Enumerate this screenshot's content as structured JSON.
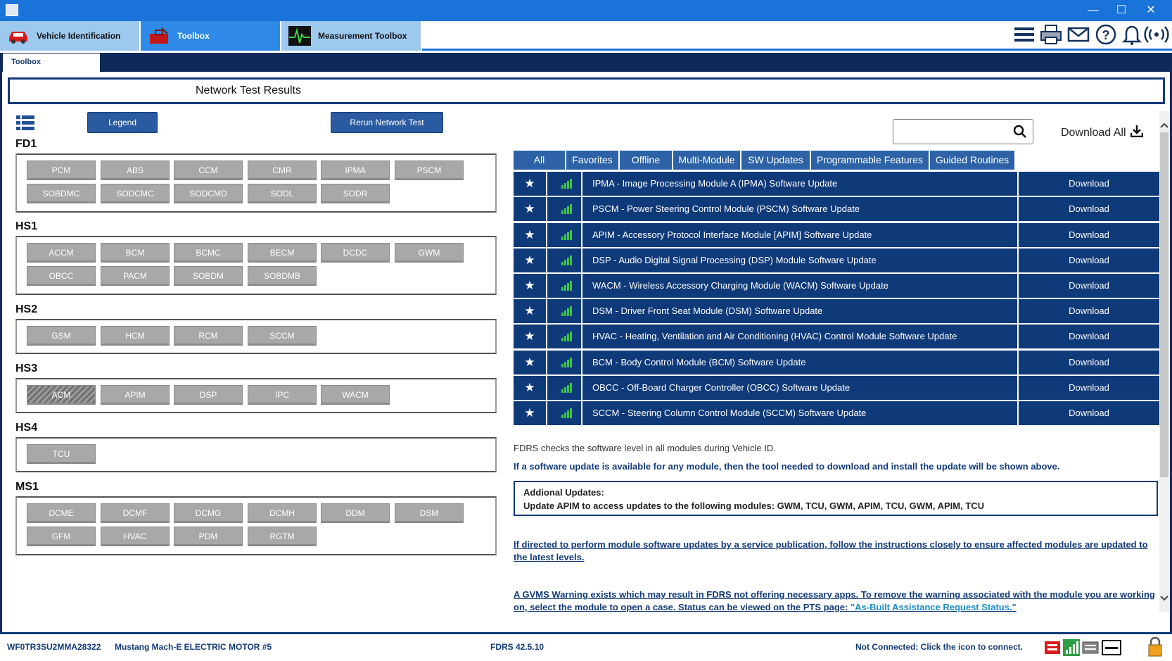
{
  "window": {
    "minimize": "—",
    "maximize": "☐",
    "close": "✕"
  },
  "top_tabs": [
    {
      "label": "Vehicle Identification",
      "icon": "car-icon"
    },
    {
      "label": "Toolbox",
      "icon": "toolbox-icon"
    },
    {
      "label": "Measurement Toolbox",
      "icon": "oscilloscope-icon"
    }
  ],
  "header_icons": [
    "menu-icon",
    "printer-icon",
    "mail-icon",
    "help-icon",
    "bell-icon",
    "wireless-icon"
  ],
  "sub_tab": "Toolbox",
  "page_title": "Network Test Results",
  "buttons": {
    "legend": "Legend",
    "rerun": "Rerun Network Test"
  },
  "groups": [
    {
      "name": "FD1",
      "modules": [
        "PCM",
        "ABS",
        "CCM",
        "CMR",
        "IPMA",
        "PSCM",
        "SOBDMC",
        "SODCMC",
        "SODCMD",
        "SODL",
        "SODR"
      ]
    },
    {
      "name": "HS1",
      "modules": [
        "ACCM",
        "BCM",
        "BCMC",
        "BECM",
        "DCDC",
        "GWM",
        "OBCC",
        "PACM",
        "SOBDM",
        "SOBDMB"
      ]
    },
    {
      "name": "HS2",
      "modules": [
        "GSM",
        "HCM",
        "RCM",
        "SCCM"
      ]
    },
    {
      "name": "HS3",
      "modules": [
        "ACM",
        "APIM",
        "DSP",
        "IPC",
        "WACM"
      ]
    },
    {
      "name": "HS4",
      "modules": [
        "TCU"
      ]
    },
    {
      "name": "MS1",
      "modules": [
        "DCME",
        "DCMF",
        "DCMG",
        "DCMH",
        "DDM",
        "DSM",
        "GFM",
        "HVAC",
        "PDM",
        "RGTM"
      ]
    }
  ],
  "search": {
    "placeholder": ""
  },
  "download_all": "Download All",
  "filter_tabs": [
    "All",
    "Favorites",
    "Offline",
    "Multi-Module",
    "SW Updates",
    "Programmable Features",
    "Guided Routines"
  ],
  "updates": [
    {
      "desc": "IPMA - Image Processing Module A (IPMA) Software Update",
      "action": "Download"
    },
    {
      "desc": "PSCM - Power Steering Control Module (PSCM) Software Update",
      "action": "Download"
    },
    {
      "desc": "APIM - Accessory Protocol Interface Module [APIM] Software Update",
      "action": "Download"
    },
    {
      "desc": "DSP - Audio Digital Signal Processing (DSP) Module Software Update",
      "action": "Download"
    },
    {
      "desc": "WACM - Wireless Accessory Charging Module (WACM) Software Update",
      "action": "Download"
    },
    {
      "desc": "DSM - Driver Front Seat Module (DSM) Software Update",
      "action": "Download"
    },
    {
      "desc": "HVAC - Heating, Ventilation and Air Conditioning (HVAC) Control Module Software Update",
      "action": "Download"
    },
    {
      "desc": "BCM - Body Control Module (BCM) Software Update",
      "action": "Download"
    },
    {
      "desc": "OBCC - Off-Board Charger Controller (OBCC) Software Update",
      "action": "Download"
    },
    {
      "desc": "SCCM - Steering Column Control Module (SCCM) Software Update",
      "action": "Download"
    }
  ],
  "info": {
    "line1": "FDRS checks the software level in all modules during Vehicle ID.",
    "line2": "If a software update is available for any module, then the tool needed to download and install the update will be shown above.",
    "additional_title": "Addional Updates:",
    "additional_body": "Update APIM to access updates to the following modules: GWM, TCU, GWM, APIM, TCU, GWM, APIM, TCU",
    "link1": "If directed to perform module software updates by a service publication, follow the instructions closely to ensure affected modules are updated to the latest levels.",
    "link2": "A GVMS Warning exists which may result in FDRS not offering necessary apps. To remove the warning associated with the module you are working on, select the module to open a case. Status can be viewed on the PTS page: ",
    "link2_tail": "\"As-Built Assistance Request Status.\""
  },
  "status": {
    "vin": "WF0TR3SU2MMA28322",
    "vehicle": "Mustang Mach-E ELECTRIC MOTOR #5",
    "version": "FDRS 42.5.10",
    "connection": "Not Connected: Click the icon to connect.",
    "icons": [
      "vci-icon",
      "signal-icon",
      "keyboard-icon",
      "dash-icon",
      "lock-icon"
    ]
  }
}
